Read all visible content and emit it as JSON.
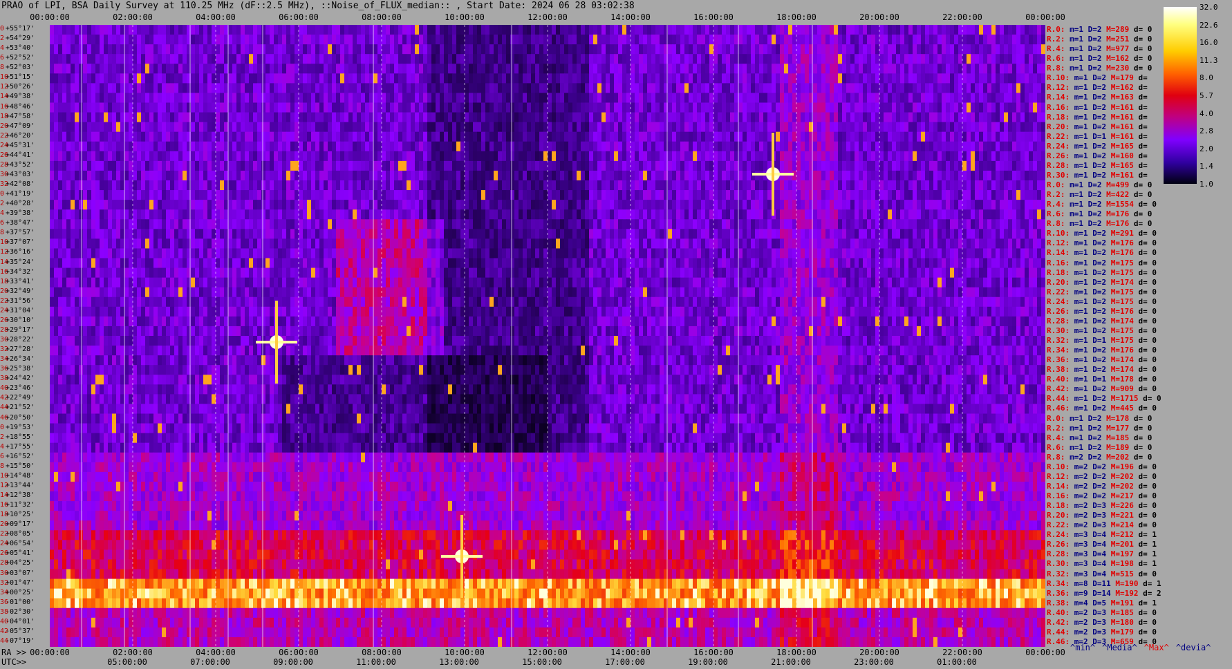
{
  "title": "PRAO of LPI, BSA Daily Survey at 110.25 MHz (dF::2.5 MHz), ::Noise_of_FLUX_median:: , Start Date: 2024 06 28 03:02:38",
  "top_ticks": [
    "00:00:00",
    "02:00:00",
    "04:00:00",
    "06:00:00",
    "08:00:00",
    "10:00:00",
    "12:00:00",
    "14:00:00",
    "16:00:00",
    "18:00:00",
    "20:00:00",
    "22:00:00",
    "00:00:00"
  ],
  "ra_label": "RA >>",
  "ra_ticks": [
    "00:00:00",
    "02:00:00",
    "04:00:00",
    "06:00:00",
    "08:00:00",
    "10:00:00",
    "12:00:00",
    "14:00:00",
    "16:00:00",
    "18:00:00",
    "20:00:00",
    "22:00:00",
    "00:00:00"
  ],
  "utc_label": "UTC>>",
  "utc_ticks": [
    "05:00:00",
    "07:00:00",
    "09:00:00",
    "11:00:00",
    "13:00:00",
    "15:00:00",
    "17:00:00",
    "19:00:00",
    "21:00:00",
    "23:00:00",
    "01:00:00"
  ],
  "colorbar": {
    "labels": [
      "32.0",
      "22.6",
      "16.0",
      "11.3",
      "8.0",
      "5.7",
      "4.0",
      "2.8",
      "2.0",
      "1.4",
      "1.0"
    ]
  },
  "legend_keys": [
    "^min^",
    "^Media^",
    "^Max^",
    "^devia^"
  ],
  "colors": {
    "low": "#120030",
    "mid": "#8000ff",
    "high": "#e00010",
    "peak": "#ffff80",
    "text_red": "#e00000",
    "text_blue": "#000080"
  },
  "chart_data": {
    "type": "heatmap",
    "title": "PRAO of LPI, BSA Daily Survey at 110.25 MHz (dF::2.5 MHz), ::Noise_of_FLUX_median:: , Start Date: 2024 06 28 03:02:38",
    "xlabel": "RA",
    "x_start": "00:00:00",
    "x_end": "00:00:00",
    "colorbar_range": [
      1.0,
      32.0
    ],
    "y_declinations": [
      "+55°17'",
      "+54°29'",
      "+53°40'",
      "+52°52'",
      "+52°03'",
      "+51°15'",
      "+50°26'",
      "+49°38'",
      "+48°46'",
      "+47°58'",
      "+47°09'",
      "+46°20'",
      "+45°31'",
      "+44°41'",
      "+43°52'",
      "+43°03'",
      "+42°08'",
      "+41°19'",
      "+40°28'",
      "+39°38'",
      "+38°47'",
      "+37°57'",
      "+37°07'",
      "+36°16'",
      "+35°24'",
      "+34°32'",
      "+33°41'",
      "+32°49'",
      "+31°56'",
      "+31°04'",
      "+30°10'",
      "+29°17'",
      "+28°22'",
      "+27°28'",
      "+26°34'",
      "+25°38'",
      "+24°42'",
      "+23°46'",
      "+22°49'",
      "+21°52'",
      "+20°50'",
      "+19°53'",
      "+18°55'",
      "+17°55'",
      "+16°52'",
      "+15°50'",
      "+14°48'",
      "+13°44'",
      "+12°38'",
      "+11°32'",
      "+10°25'",
      "+09°17'",
      "+08°05'",
      "+06°54'",
      "+05°41'",
      "+04°25'",
      "+03°07'",
      "+01°47'",
      "+00°25'",
      "-01°00'",
      "-02°30'",
      "-04°01'",
      "-05°37'",
      "-07°19'"
    ],
    "y_indices": [
      "0",
      "2",
      "4",
      "6",
      "8",
      "10",
      "12",
      "14",
      "16",
      "18",
      "20",
      "22",
      "24",
      "26",
      "28",
      "30",
      "32",
      "0",
      "2",
      "4",
      "6",
      "8",
      "10",
      "12",
      "14",
      "16",
      "18",
      "20",
      "22",
      "24",
      "26",
      "28",
      "30",
      "32",
      "34",
      "36",
      "38",
      "40",
      "42",
      "44",
      "46",
      "0",
      "2",
      "4",
      "6",
      "8",
      "10",
      "12",
      "14",
      "16",
      "18",
      "20",
      "22",
      "24",
      "26",
      "28",
      "30",
      "32",
      "34",
      "36",
      "38",
      "40",
      "42",
      "44",
      "46"
    ],
    "rows": [
      {
        "label": "R.0:",
        "m": "m=1",
        "d": "D=2",
        "M": "M=289",
        "dev": "d= 0"
      },
      {
        "label": "R.2:",
        "m": "m=1",
        "d": "D=2",
        "M": "M=251",
        "dev": "d= 0"
      },
      {
        "label": "R.4:",
        "m": "m=1",
        "d": "D=2",
        "M": "M=977",
        "dev": "d= 0"
      },
      {
        "label": "R.6:",
        "m": "m=1",
        "d": "D=2",
        "M": "M=162",
        "dev": "d= 0"
      },
      {
        "label": "R.8:",
        "m": "m=1",
        "d": "D=2",
        "M": "M=230",
        "dev": "d= 0"
      },
      {
        "label": "R.10:",
        "m": "m=1",
        "d": "D=2",
        "M": "M=179",
        "dev": "d="
      },
      {
        "label": "R.12:",
        "m": "m=1",
        "d": "D=2",
        "M": "M=162",
        "dev": "d="
      },
      {
        "label": "R.14:",
        "m": "m=1",
        "d": "D=2",
        "M": "M=163",
        "dev": "d="
      },
      {
        "label": "R.16:",
        "m": "m=1",
        "d": "D=2",
        "M": "M=161",
        "dev": "d="
      },
      {
        "label": "R.18:",
        "m": "m=1",
        "d": "D=2",
        "M": "M=161",
        "dev": "d="
      },
      {
        "label": "R.20:",
        "m": "m=1",
        "d": "D=2",
        "M": "M=161",
        "dev": "d="
      },
      {
        "label": "R.22:",
        "m": "m=1",
        "d": "D=1",
        "M": "M=161",
        "dev": "d="
      },
      {
        "label": "R.24:",
        "m": "m=1",
        "d": "D=2",
        "M": "M=165",
        "dev": "d="
      },
      {
        "label": "R.26:",
        "m": "m=1",
        "d": "D=2",
        "M": "M=160",
        "dev": "d="
      },
      {
        "label": "R.28:",
        "m": "m=1",
        "d": "D=2",
        "M": "M=165",
        "dev": "d="
      },
      {
        "label": "R.30:",
        "m": "m=1",
        "d": "D=2",
        "M": "M=161",
        "dev": "d="
      },
      {
        "label": "R.0:",
        "m": "m=1",
        "d": "D=2",
        "M": "M=499",
        "dev": "d= 0"
      },
      {
        "label": "R.2:",
        "m": "m=1",
        "d": "D=2",
        "M": "M=422",
        "dev": "d= 0"
      },
      {
        "label": "R.4:",
        "m": "m=1",
        "d": "D=2",
        "M": "M=1554",
        "dev": "d= 0"
      },
      {
        "label": "R.6:",
        "m": "m=1",
        "d": "D=2",
        "M": "M=176",
        "dev": "d= 0"
      },
      {
        "label": "R.8:",
        "m": "m=1",
        "d": "D=2",
        "M": "M=176",
        "dev": "d= 0"
      },
      {
        "label": "R.10:",
        "m": "m=1",
        "d": "D=2",
        "M": "M=291",
        "dev": "d= 0"
      },
      {
        "label": "R.12:",
        "m": "m=1",
        "d": "D=2",
        "M": "M=176",
        "dev": "d= 0"
      },
      {
        "label": "R.14:",
        "m": "m=1",
        "d": "D=2",
        "M": "M=176",
        "dev": "d= 0"
      },
      {
        "label": "R.16:",
        "m": "m=1",
        "d": "D=2",
        "M": "M=175",
        "dev": "d= 0"
      },
      {
        "label": "R.18:",
        "m": "m=1",
        "d": "D=2",
        "M": "M=175",
        "dev": "d= 0"
      },
      {
        "label": "R.20:",
        "m": "m=1",
        "d": "D=2",
        "M": "M=174",
        "dev": "d= 0"
      },
      {
        "label": "R.22:",
        "m": "m=1",
        "d": "D=2",
        "M": "M=175",
        "dev": "d= 0"
      },
      {
        "label": "R.24:",
        "m": "m=1",
        "d": "D=2",
        "M": "M=175",
        "dev": "d= 0"
      },
      {
        "label": "R.26:",
        "m": "m=1",
        "d": "D=2",
        "M": "M=176",
        "dev": "d= 0"
      },
      {
        "label": "R.28:",
        "m": "m=1",
        "d": "D=2",
        "M": "M=174",
        "dev": "d= 0"
      },
      {
        "label": "R.30:",
        "m": "m=1",
        "d": "D=2",
        "M": "M=175",
        "dev": "d= 0"
      },
      {
        "label": "R.32:",
        "m": "m=1",
        "d": "D=1",
        "M": "M=175",
        "dev": "d= 0"
      },
      {
        "label": "R.34:",
        "m": "m=1",
        "d": "D=2",
        "M": "M=176",
        "dev": "d= 0"
      },
      {
        "label": "R.36:",
        "m": "m=1",
        "d": "D=2",
        "M": "M=174",
        "dev": "d= 0"
      },
      {
        "label": "R.38:",
        "m": "m=1",
        "d": "D=2",
        "M": "M=174",
        "dev": "d= 0"
      },
      {
        "label": "R.40:",
        "m": "m=1",
        "d": "D=1",
        "M": "M=178",
        "dev": "d= 0"
      },
      {
        "label": "R.42:",
        "m": "m=1",
        "d": "D=2",
        "M": "M=909",
        "dev": "d= 0"
      },
      {
        "label": "R.44:",
        "m": "m=1",
        "d": "D=2",
        "M": "M=1715",
        "dev": "d= 0"
      },
      {
        "label": "R.46:",
        "m": "m=1",
        "d": "D=2",
        "M": "M=445",
        "dev": "d= 0"
      },
      {
        "label": "R.0:",
        "m": "m=1",
        "d": "D=2",
        "M": "M=178",
        "dev": "d= 0"
      },
      {
        "label": "R.2:",
        "m": "m=1",
        "d": "D=2",
        "M": "M=177",
        "dev": "d= 0"
      },
      {
        "label": "R.4:",
        "m": "m=1",
        "d": "D=2",
        "M": "M=185",
        "dev": "d= 0"
      },
      {
        "label": "R.6:",
        "m": "m=1",
        "d": "D=2",
        "M": "M=189",
        "dev": "d= 0"
      },
      {
        "label": "R.8:",
        "m": "m=2",
        "d": "D=2",
        "M": "M=202",
        "dev": "d= 0"
      },
      {
        "label": "R.10:",
        "m": "m=2",
        "d": "D=2",
        "M": "M=196",
        "dev": "d= 0"
      },
      {
        "label": "R.12:",
        "m": "m=2",
        "d": "D=2",
        "M": "M=202",
        "dev": "d= 0"
      },
      {
        "label": "R.14:",
        "m": "m=2",
        "d": "D=2",
        "M": "M=202",
        "dev": "d= 0"
      },
      {
        "label": "R.16:",
        "m": "m=2",
        "d": "D=2",
        "M": "M=217",
        "dev": "d= 0"
      },
      {
        "label": "R.18:",
        "m": "m=2",
        "d": "D=3",
        "M": "M=226",
        "dev": "d= 0"
      },
      {
        "label": "R.20:",
        "m": "m=2",
        "d": "D=3",
        "M": "M=221",
        "dev": "d= 0"
      },
      {
        "label": "R.22:",
        "m": "m=2",
        "d": "D=3",
        "M": "M=214",
        "dev": "d= 0"
      },
      {
        "label": "R.24:",
        "m": "m=3",
        "d": "D=4",
        "M": "M=212",
        "dev": "d= 1"
      },
      {
        "label": "R.26:",
        "m": "m=3",
        "d": "D=4",
        "M": "M=201",
        "dev": "d= 1"
      },
      {
        "label": "R.28:",
        "m": "m=3",
        "d": "D=4",
        "M": "M=197",
        "dev": "d= 1"
      },
      {
        "label": "R.30:",
        "m": "m=3",
        "d": "D=4",
        "M": "M=198",
        "dev": "d= 1"
      },
      {
        "label": "R.32:",
        "m": "m=3",
        "d": "D=4",
        "M": "M=515",
        "dev": "d= 0"
      },
      {
        "label": "R.34:",
        "m": "m=8",
        "d": "D=11",
        "M": "M=190",
        "dev": "d= 1"
      },
      {
        "label": "R.36:",
        "m": "m=9",
        "d": "D=14",
        "M": "M=192",
        "dev": "d= 2"
      },
      {
        "label": "R.38:",
        "m": "m=4",
        "d": "D=5",
        "M": "M=191",
        "dev": "d= 1"
      },
      {
        "label": "R.40:",
        "m": "m=2",
        "d": "D=3",
        "M": "M=185",
        "dev": "d= 0"
      },
      {
        "label": "R.42:",
        "m": "m=2",
        "d": "D=3",
        "M": "M=180",
        "dev": "d= 0"
      },
      {
        "label": "R.44:",
        "m": "m=2",
        "d": "D=3",
        "M": "M=179",
        "dev": "d= 0"
      },
      {
        "label": "R.46:",
        "m": "m=2",
        "d": "D=3",
        "M": "M=659",
        "dev": "d= 0"
      }
    ]
  }
}
